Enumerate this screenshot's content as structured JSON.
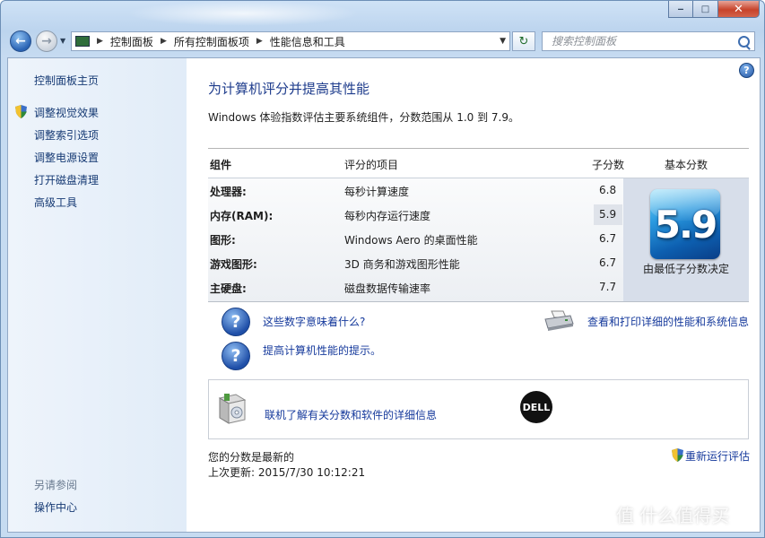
{
  "window": {
    "minimize": "‒",
    "maximize": "□",
    "close": "✕"
  },
  "nav": {
    "back_glyph": "←",
    "forward_glyph": "→",
    "breadcrumbs": [
      "控制面板",
      "所有控制面板项",
      "性能信息和工具"
    ],
    "refresh_glyph": "↻",
    "search_placeholder": "搜索控制面板"
  },
  "sidebar": {
    "home": "控制面板主页",
    "links": [
      "调整视觉效果",
      "调整索引选项",
      "调整电源设置",
      "打开磁盘清理",
      "高级工具"
    ],
    "see_also": "另请参阅",
    "see_also_links": [
      "操作中心"
    ]
  },
  "main": {
    "help_glyph": "?",
    "title": "为计算机评分并提高其性能",
    "subtitle": "Windows 体验指数评估主要系统组件，分数范围从 1.0 到 7.9。",
    "table": {
      "headers": [
        "组件",
        "评分的项目",
        "子分数",
        "基本分数"
      ],
      "rows": [
        {
          "component": "处理器:",
          "item": "每秒计算速度",
          "subscore": "6.8"
        },
        {
          "component": "内存(RAM):",
          "item": "每秒内存运行速度",
          "subscore": "5.9"
        },
        {
          "component": "图形:",
          "item": "Windows Aero 的桌面性能",
          "subscore": "6.7"
        },
        {
          "component": "游戏图形:",
          "item": "3D 商务和游戏图形性能",
          "subscore": "6.7"
        },
        {
          "component": "主硬盘:",
          "item": "磁盘数据传输速率",
          "subscore": "7.7"
        }
      ],
      "base_score": "5.9",
      "base_note": "由最低子分数决定"
    },
    "links": {
      "what_numbers_mean": "这些数字意味着什么?",
      "tips": "提高计算机性能的提示。",
      "view_print": "查看和打印详细的性能和系统信息",
      "learn_online": "联机了解有关分数和软件的详细信息",
      "rerun": "重新运行评估"
    },
    "oem_logo": "DELL",
    "status": "您的分数是最新的",
    "last_update": "上次更新: 2015/7/30 10:12:21"
  },
  "watermark": "值 什么值得买",
  "colors": {
    "link": "#163a9c",
    "title": "#1e3c8c",
    "badge": "#1a7fd0"
  }
}
